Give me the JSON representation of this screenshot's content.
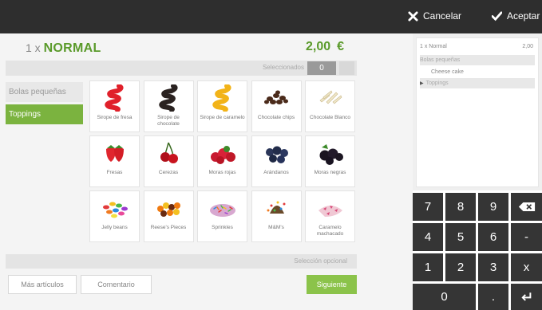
{
  "header": {
    "cancel_label": "Cancelar",
    "accept_label": "Aceptar"
  },
  "product": {
    "quantity_prefix": "1 x",
    "name": "NORMAL",
    "price": "2,00",
    "currency": "€"
  },
  "selection_bar": {
    "label": "Seleccionados",
    "count": "0"
  },
  "categories": [
    {
      "label": "Bolas pequeñas",
      "active": false
    },
    {
      "label": "Toppings",
      "active": true
    }
  ],
  "toppings": [
    {
      "label": "Sirope de fresa",
      "icon": "strawberry-syrup-icon"
    },
    {
      "label": "Sirope de chocolate",
      "icon": "chocolate-syrup-icon"
    },
    {
      "label": "Sirope de caramelo",
      "icon": "caramel-syrup-icon"
    },
    {
      "label": "Chocolate chips",
      "icon": "chocolate-chips-icon"
    },
    {
      "label": "Chocolate Blanco",
      "icon": "white-chocolate-icon"
    },
    {
      "label": "Fresas",
      "icon": "strawberries-icon"
    },
    {
      "label": "Cerezas",
      "icon": "cherries-icon"
    },
    {
      "label": "Moras rojas",
      "icon": "raspberries-icon"
    },
    {
      "label": "Arándanos",
      "icon": "blueberries-icon"
    },
    {
      "label": "Moras negras",
      "icon": "blackberries-icon"
    },
    {
      "label": "Jelly beans",
      "icon": "jelly-beans-icon"
    },
    {
      "label": "Reese's Pieces",
      "icon": "reeses-pieces-icon"
    },
    {
      "label": "Sprinkles",
      "icon": "sprinkles-icon"
    },
    {
      "label": "M&M's",
      "icon": "mms-icon"
    },
    {
      "label": "Caramelo machacado",
      "icon": "crushed-candy-icon"
    }
  ],
  "optional_bar": {
    "label": "Selección opcional"
  },
  "bottom_buttons": {
    "more_items": "Más artículos",
    "comment": "Comentario",
    "next": "Siguiente"
  },
  "order": {
    "lines": [
      {
        "label": "1 x Normal",
        "value": "2,00",
        "highlight": false
      },
      {
        "label": "Bolas pequeñas",
        "value": "",
        "highlight": true
      },
      {
        "label": "Cheese cake",
        "value": "",
        "highlight": false
      },
      {
        "label": "Toppings",
        "value": "",
        "highlight": true
      }
    ]
  },
  "keypad": {
    "keys": [
      "7",
      "8",
      "9",
      "4",
      "5",
      "6",
      "-",
      "1",
      "2",
      "3",
      "x",
      "0",
      "."
    ]
  },
  "colors": {
    "accent_green": "#7bb33f",
    "topbar": "#2e2e2e",
    "key_dark": "#353535"
  }
}
